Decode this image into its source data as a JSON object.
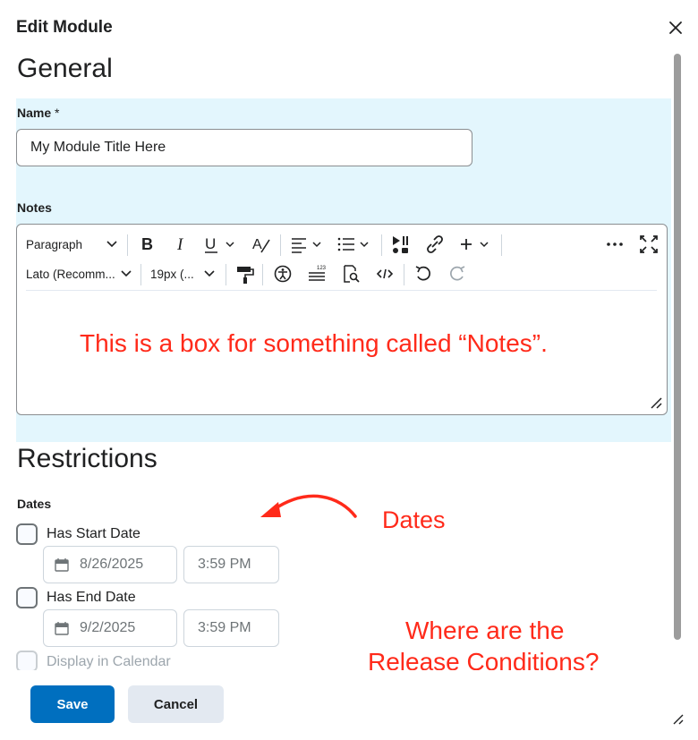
{
  "dialog": {
    "title": "Edit Module",
    "close_icon": "close-icon"
  },
  "general": {
    "heading": "General",
    "name_label": "Name",
    "name_required_marker": "*",
    "name_value": "My Module Title Here",
    "notes_label": "Notes"
  },
  "editor": {
    "block_format": "Paragraph",
    "font_family": "Lato (Recomm...",
    "font_size": "19px (...",
    "content": "This is a box for something called “Notes”.",
    "icons": [
      "bold-icon",
      "italic-icon",
      "underline-icon",
      "text-color-icon",
      "align-icon",
      "list-icon",
      "insert-media-icon",
      "link-icon",
      "add-icon",
      "more-icon",
      "fullscreen-icon",
      "format-painter-icon",
      "accessibility-icon",
      "word-count-icon",
      "find-replace-icon",
      "source-code-icon",
      "undo-icon",
      "redo-icon"
    ]
  },
  "restrictions": {
    "heading": "Restrictions",
    "dates_label": "Dates",
    "start": {
      "label": "Has Start Date",
      "date": "8/26/2025",
      "time": "3:59 PM"
    },
    "end": {
      "label": "Has End Date",
      "date": "9/2/2025",
      "time": "3:59 PM"
    },
    "calendar_label": "Display in Calendar"
  },
  "annotations": {
    "dates": "Dates",
    "release_line1": "Where are the",
    "release_line2": "Release Conditions?"
  },
  "footer": {
    "save_label": "Save",
    "cancel_label": "Cancel"
  },
  "colors": {
    "primary": "#006fbf",
    "highlight": "#e3f6fd",
    "annotation": "#ff2a1a"
  }
}
